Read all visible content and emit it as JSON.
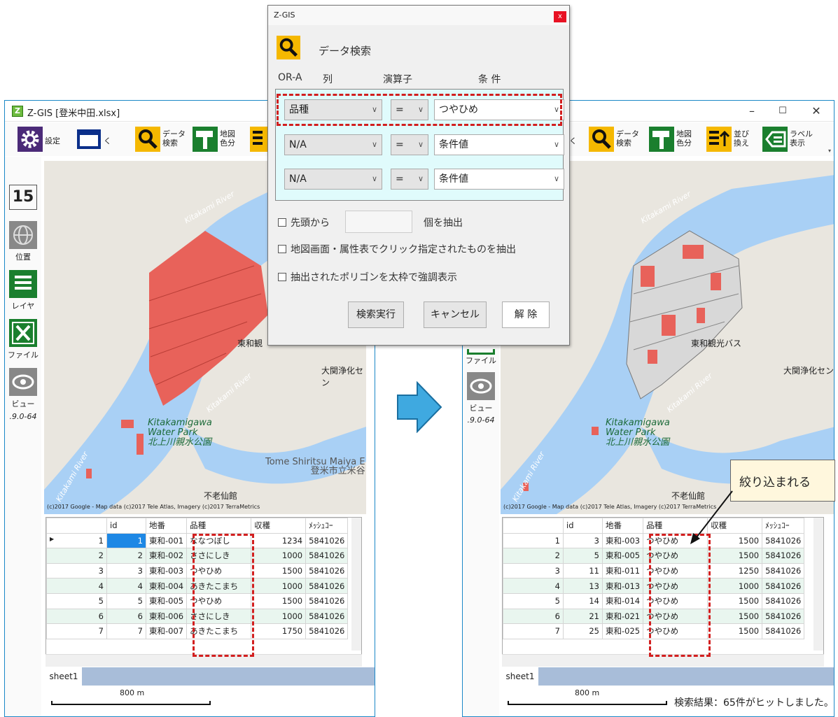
{
  "left": {
    "title": "Z-GIS [登米中田.xlsx]",
    "settings": "設定",
    "open": "開く",
    "search": "データ\n検索",
    "color": "地図\n色分"
  },
  "right": {
    "min": "–",
    "max": "☐",
    "close": "✕",
    "open": "く",
    "search": "データ\n検索",
    "color": "地図\n色分",
    "sort": "並び\n換え",
    "label": "ラベル\n表示",
    "result": "検索結果：65件がヒットしました。"
  },
  "side": {
    "num": "15",
    "pos": "位置",
    "layer": "レイヤ",
    "file": "ファイル",
    "view": "ビュー",
    "ver": ".9.0-64"
  },
  "map": {
    "river1": "Kitakami River",
    "river2": "Kitakami River",
    "river3": "Kitakami River",
    "bus": "東和観光バス",
    "center": "大関浄化セン",
    "park1": "Kitakamigawa",
    "park2": "Water Park",
    "park3": "北上川親水公園",
    "school1": "Tome Shiritsu Maiya E",
    "school2": "登米市立米谷",
    "shop": "不老仙館",
    "copy": "(c)2017 Google - Map data (c)2017 Tele Atlas, Imagery (c)2017 TerraMetrics",
    "scale": "800 m",
    "sheet": "sheet1",
    "bus_short": "東和観"
  },
  "headers": [
    "id",
    "地番",
    "品種",
    "収穫",
    "ﾒｯｼｭｺｰ"
  ],
  "left_rows": [
    {
      "n": "1",
      "id": "1",
      "ch": "東和-001",
      "hs": "ななつぼし",
      "sy": "1234",
      "ms": "5841026"
    },
    {
      "n": "2",
      "id": "2",
      "ch": "東和-002",
      "hs": "ささにしき",
      "sy": "1000",
      "ms": "5841026"
    },
    {
      "n": "3",
      "id": "3",
      "ch": "東和-003",
      "hs": "つやひめ",
      "sy": "1500",
      "ms": "5841026"
    },
    {
      "n": "4",
      "id": "4",
      "ch": "東和-004",
      "hs": "あきたこまち",
      "sy": "1000",
      "ms": "5841026"
    },
    {
      "n": "5",
      "id": "5",
      "ch": "東和-005",
      "hs": "つやひめ",
      "sy": "1500",
      "ms": "5841026"
    },
    {
      "n": "6",
      "id": "6",
      "ch": "東和-006",
      "hs": "ささにしき",
      "sy": "1000",
      "ms": "5841026"
    },
    {
      "n": "7",
      "id": "7",
      "ch": "東和-007",
      "hs": "あきたこまち",
      "sy": "1750",
      "ms": "5841026"
    }
  ],
  "right_rows": [
    {
      "n": "1",
      "id": "3",
      "ch": "東和-003",
      "hs": "つやひめ",
      "sy": "1500",
      "ms": "5841026"
    },
    {
      "n": "2",
      "id": "5",
      "ch": "東和-005",
      "hs": "つやひめ",
      "sy": "1500",
      "ms": "5841026"
    },
    {
      "n": "3",
      "id": "11",
      "ch": "東和-011",
      "hs": "つやひめ",
      "sy": "1250",
      "ms": "5841026"
    },
    {
      "n": "4",
      "id": "13",
      "ch": "東和-013",
      "hs": "つやひめ",
      "sy": "1000",
      "ms": "5841026"
    },
    {
      "n": "5",
      "id": "14",
      "ch": "東和-014",
      "hs": "つやひめ",
      "sy": "1500",
      "ms": "5841026"
    },
    {
      "n": "6",
      "id": "21",
      "ch": "東和-021",
      "hs": "つやひめ",
      "sy": "1500",
      "ms": "5841026"
    },
    {
      "n": "7",
      "id": "25",
      "ch": "東和-025",
      "hs": "つやひめ",
      "sy": "1500",
      "ms": "5841026"
    }
  ],
  "dialog": {
    "title": "Z-GIS",
    "close": "x",
    "heading": "データ検索",
    "col_ora": "OR-A",
    "col_col": "列",
    "col_op": "演算子",
    "col_cond": "条 件",
    "r1c": "品種",
    "r1o": "=",
    "r1v": "つやひめ",
    "r2c": "N/A",
    "r2o": "=",
    "r2v": "条件値",
    "r3c": "N/A",
    "r3o": "=",
    "r3v": "条件値",
    "opt1": "先頭から",
    "opt1b": "個を抽出",
    "opt2": "地図画面・属性表でクリック指定されたものを抽出",
    "opt3": "抽出されたポリゴンを太枠で強調表示",
    "run": "検索実行",
    "cancel": "キャンセル",
    "clear": "解 除"
  },
  "callout": "絞り込まれる",
  "colors": {
    "accent": "#d21f1f",
    "water": "#a9d0f5",
    "polygon": "#e8625a",
    "arrow": "#3fa9e0"
  }
}
